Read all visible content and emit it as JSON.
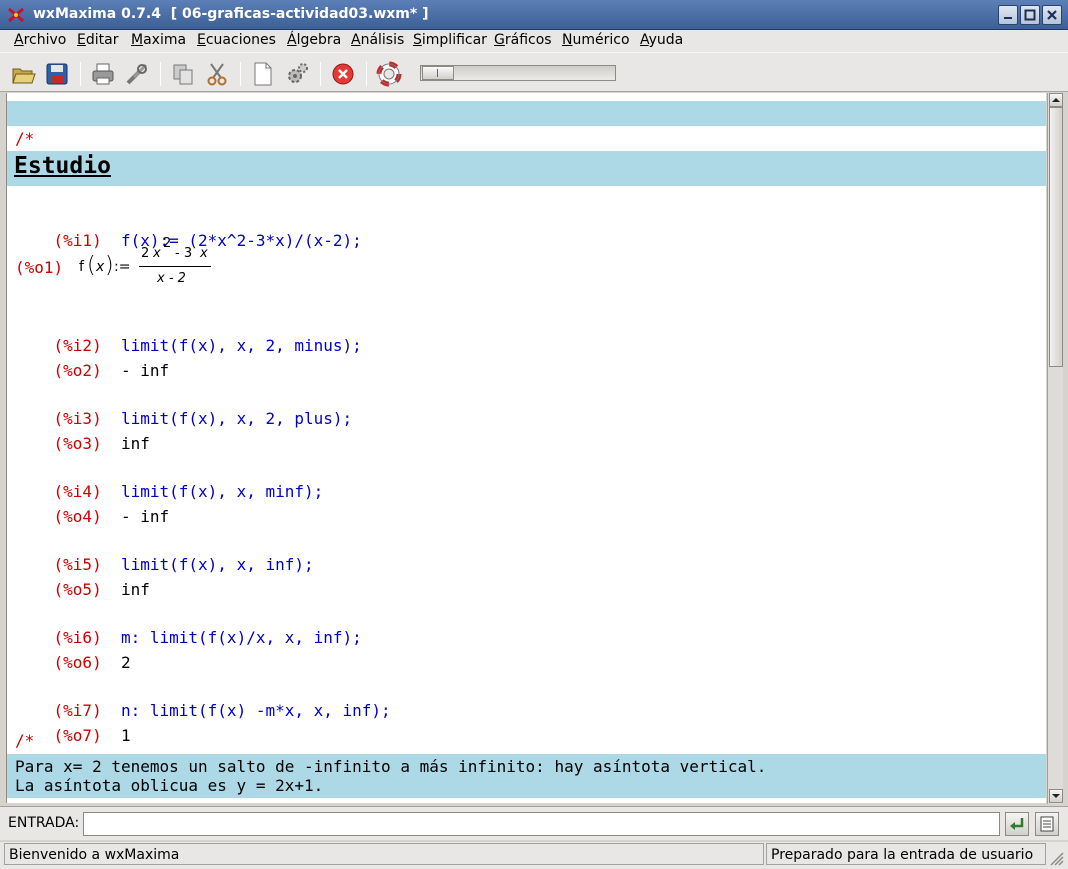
{
  "window": {
    "title": "wxMaxima 0.7.4  [ 06-graficas-actividad03.wxm* ]"
  },
  "menu": {
    "items": [
      {
        "u": "A",
        "rest": "rchivo"
      },
      {
        "u": "E",
        "rest": "ditar"
      },
      {
        "u": "M",
        "rest": "axima"
      },
      {
        "u": "E",
        "rest": "cuaciones"
      },
      {
        "u": "Á",
        "rest": "lgebra"
      },
      {
        "u": "A",
        "rest": "nálisis"
      },
      {
        "u": "S",
        "rest": "implificar"
      },
      {
        "u": "G",
        "rest": "ráficos"
      },
      {
        "u": "N",
        "rest": "umérico"
      },
      {
        "u": "A",
        "rest": "yuda"
      }
    ]
  },
  "toolbar": {
    "icons": [
      "open-icon",
      "save-icon",
      "print-icon",
      "config-icon",
      "copy-icon",
      "cut-icon",
      "new-icon",
      "settings-icon",
      "interrupt-icon",
      "help-icon"
    ],
    "slider_fraction": 0.0
  },
  "document": {
    "comment_open_1": "/*",
    "section_title": "Estudio",
    "cells": [
      {
        "in_label": "(%i1)",
        "input": "f(x):= (2*x^2-3*x)/(x-2);",
        "out_label": "(%o1)",
        "output": ""
      },
      {
        "in_label": "(%i2)",
        "input": "limit(f(x), x, 2, minus);",
        "out_label": "(%o2)",
        "output": "- inf"
      },
      {
        "in_label": "(%i3)",
        "input": "limit(f(x), x, 2, plus);",
        "out_label": "(%o3)",
        "output": "inf"
      },
      {
        "in_label": "(%i4)",
        "input": "limit(f(x), x, minf);",
        "out_label": "(%o4)",
        "output": "- inf"
      },
      {
        "in_label": "(%i5)",
        "input": "limit(f(x), x, inf);",
        "out_label": "(%o5)",
        "output": "inf"
      },
      {
        "in_label": "(%i6)",
        "input": "m: limit(f(x)/x, x, inf);",
        "out_label": "(%o6)",
        "output": "2"
      },
      {
        "in_label": "(%i7)",
        "input": "n: limit(f(x) -m*x, x, inf);",
        "out_label": "(%o7)",
        "output": "1"
      }
    ],
    "o1_math": {
      "lhs": "f",
      "var": "x",
      "assign": ":=",
      "num_coef": "2",
      "num_var": "x",
      "num_exp": "2",
      "num_rest": "- 3",
      "num_var2": "x",
      "den": "x - 2"
    },
    "comment_open_2": "/*",
    "comment_text_1": "Para x= 2 tenemos un salto de -infinito a más infinito: hay asíntota vertical.",
    "comment_text_2": "La asíntota oblicua es y = 2x+1."
  },
  "entry": {
    "label": "ENTRADA:",
    "value": ""
  },
  "status": {
    "left": "Bienvenido a wxMaxima",
    "right": "Preparado para la entrada de usuario"
  },
  "colors": {
    "title_bar": "#4a6fa5",
    "band": "#add8e6",
    "label_red": "#cc0000",
    "input_blue": "#0000cc"
  }
}
